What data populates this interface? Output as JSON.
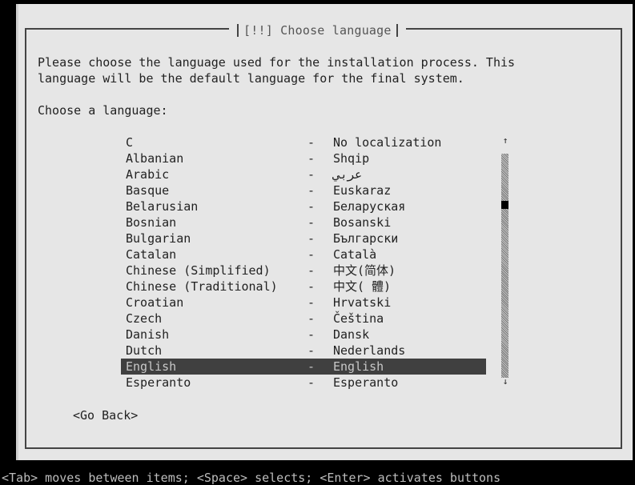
{
  "dialog": {
    "title": "[!!] Choose language",
    "description_line1": "Please choose the language used for the installation process. This",
    "description_line2": "language will be the default language for the final system.",
    "prompt": "Choose a language:"
  },
  "languages": [
    {
      "name": "C",
      "native": "No localization"
    },
    {
      "name": "Albanian",
      "native": "Shqip"
    },
    {
      "name": "Arabic",
      "native": "عربي"
    },
    {
      "name": "Basque",
      "native": "Euskaraz"
    },
    {
      "name": "Belarusian",
      "native": "Беларуская"
    },
    {
      "name": "Bosnian",
      "native": "Bosanski"
    },
    {
      "name": "Bulgarian",
      "native": "Български"
    },
    {
      "name": "Catalan",
      "native": "Català"
    },
    {
      "name": "Chinese (Simplified)",
      "native": "中文(简体)"
    },
    {
      "name": "Chinese (Traditional)",
      "native": "中文( 體)"
    },
    {
      "name": "Croatian",
      "native": "Hrvatski"
    },
    {
      "name": "Czech",
      "native": "Čeština"
    },
    {
      "name": "Danish",
      "native": "Dansk"
    },
    {
      "name": "Dutch",
      "native": "Nederlands"
    },
    {
      "name": "English",
      "native": "English"
    },
    {
      "name": "Esperanto",
      "native": "Esperanto"
    }
  ],
  "selected_language": "English",
  "separator": "-",
  "scroll": {
    "up_icon": "↑",
    "down_icon": "↓"
  },
  "buttons": {
    "go_back": "<Go Back>"
  },
  "footer": "<Tab> moves between items; <Space> selects; <Enter> activates buttons",
  "colors": {
    "background": "#000000",
    "dialog": "#e6e6e6",
    "selection": "#404040"
  }
}
